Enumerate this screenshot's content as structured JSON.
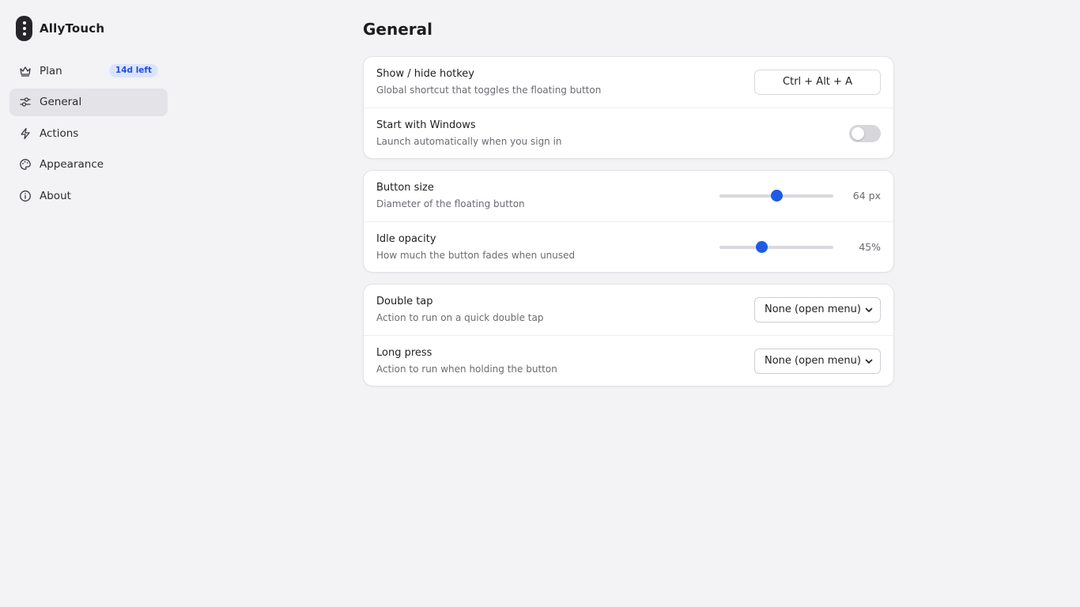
{
  "app": {
    "name": "AllyTouch"
  },
  "sidebar": {
    "items": [
      {
        "label": "Plan",
        "icon": "crown-icon",
        "badge": "14d left",
        "active": false
      },
      {
        "label": "General",
        "icon": "sliders-icon",
        "active": true
      },
      {
        "label": "Actions",
        "icon": "bolt-icon",
        "active": false
      },
      {
        "label": "Appearance",
        "icon": "palette-icon",
        "active": false
      },
      {
        "label": "About",
        "icon": "info-icon",
        "active": false
      }
    ]
  },
  "main": {
    "title": "General",
    "hotkey_card": {
      "hotkey": {
        "title": "Show / hide hotkey",
        "description": "Global shortcut that toggles the floating button",
        "value": "Ctrl + Alt + A"
      },
      "startup": {
        "title": "Start with Windows",
        "description": "Launch automatically when you sign in",
        "enabled": false
      }
    },
    "button_card": {
      "size": {
        "title": "Button size",
        "description": "Diameter of the floating button",
        "value_label": "64 px",
        "fraction": 0.5
      },
      "opacity": {
        "title": "Idle opacity",
        "description": "How much the button fades when unused",
        "value_label": "45%",
        "fraction": 0.37
      }
    },
    "gesture_card": {
      "double_tap": {
        "title": "Double tap",
        "description": "Action to run on a quick double tap",
        "selected": "None (open menu)"
      },
      "long_press": {
        "title": "Long press",
        "description": "Action to run when holding the button",
        "selected": "None (open menu)"
      }
    }
  },
  "colors": {
    "accent": "#1f5ae6",
    "badge_bg": "#dbe4ff",
    "badge_text": "#2350d8",
    "background": "#f3f3f5",
    "active_nav": "#e4e4e8"
  }
}
